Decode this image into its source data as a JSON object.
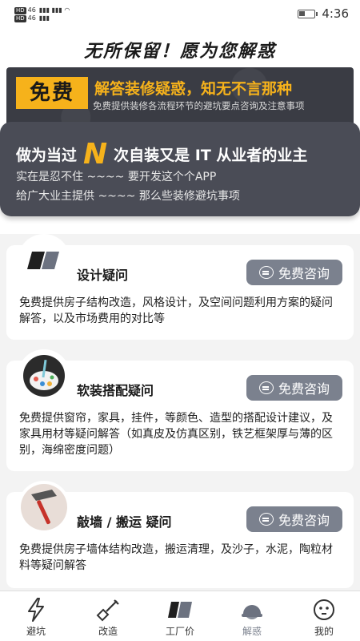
{
  "status_bar": {
    "hd_label": "HD",
    "signal_label": "46",
    "time": "4:36"
  },
  "hero": {
    "title": "无所保留！愿为您解惑",
    "badge": "免费",
    "headline": "解答装修疑惑，知无不言那种",
    "subline": "免费提供装修各流程环节的避坑要点咨询及注意事项",
    "panel_pre": "做为当过",
    "panel_n": "N",
    "panel_post": "次自装又是 IT 从业者的业主",
    "line1": "实在是忍不住 ~~~~ 要开发这个个APP",
    "line2": "给广大业主提供 ~~~~ 那么些装修避坑事项"
  },
  "cards": [
    {
      "icon": "design-swatch-icon",
      "title": "设计疑问",
      "button": "免费咨询",
      "desc": "免费提供房子结构改造，风格设计，及空间问题利用方案的疑问解答，以及市场费用的对比等"
    },
    {
      "icon": "paint-palette-icon",
      "title": "软装搭配疑问",
      "button": "免费咨询",
      "desc": "免费提供窗帘，家具，挂件，等颜色、造型的搭配设计建议，及家具用材等疑问解答（如真皮及仿真区别，铁艺框架厚与薄的区别，海绵密度问题）"
    },
    {
      "icon": "hammer-icon",
      "title": "敲墙 / 搬运 疑问",
      "button": "免费咨询",
      "desc": "免费提供房子墙体结构改造，搬运清理，及沙子，水泥，陶粒材料等疑问解答"
    }
  ],
  "nav": [
    {
      "label": "避坑",
      "icon": "lightning-icon"
    },
    {
      "label": "改造",
      "icon": "shovel-icon"
    },
    {
      "label": "工厂价",
      "icon": "factory-icon"
    },
    {
      "label": "解惑",
      "icon": "helmet-icon",
      "active": true
    },
    {
      "label": "我的",
      "icon": "face-icon"
    }
  ],
  "colors": {
    "accent": "#f6b21b",
    "dark_panel": "#4a4c56",
    "button": "#7b818e"
  }
}
